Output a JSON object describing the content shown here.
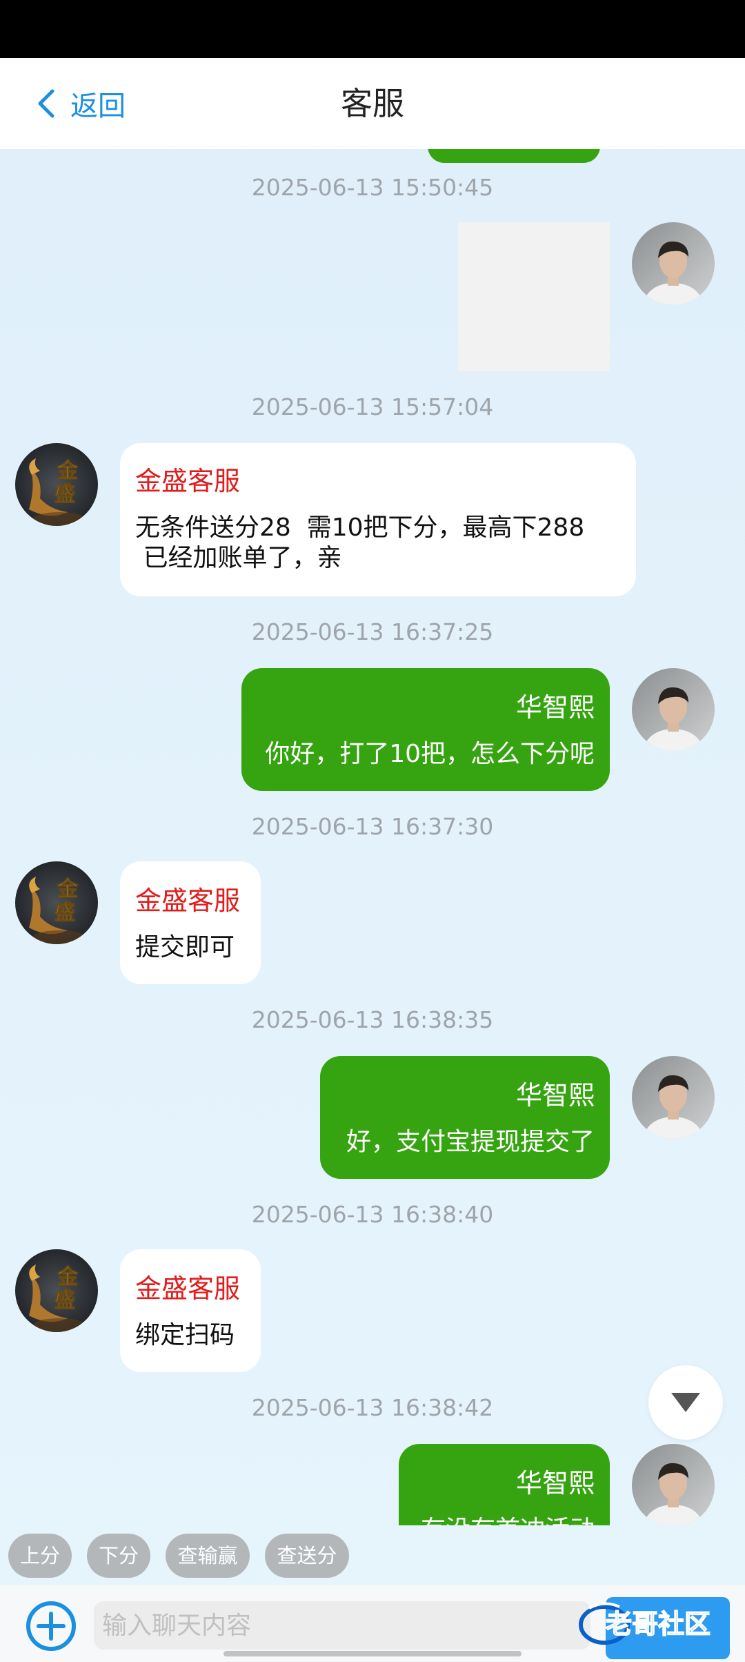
{
  "header": {
    "back_label": "返回",
    "title": "客服"
  },
  "messages": [
    {
      "timestamp": "2025-06-13 15:50:45",
      "side": "right",
      "type": "image"
    },
    {
      "timestamp": "2025-06-13 15:57:04",
      "side": "left",
      "sender": "金盛客服",
      "lines": [
        "无条件送分28  需10把下分，最高下288",
        " 已经加账单了，亲"
      ]
    },
    {
      "timestamp": "2025-06-13 16:37:25",
      "side": "right",
      "sender": "华智熙",
      "lines": [
        "你好，打了10把，怎么下分呢"
      ]
    },
    {
      "timestamp": "2025-06-13 16:37:30",
      "side": "left",
      "sender": "金盛客服",
      "lines": [
        "提交即可"
      ]
    },
    {
      "timestamp": "2025-06-13 16:38:35",
      "side": "right",
      "sender": "华智熙",
      "lines": [
        "好，支付宝提现提交了"
      ]
    },
    {
      "timestamp": "2025-06-13 16:38:40",
      "side": "left",
      "sender": "金盛客服",
      "lines": [
        "绑定扫码"
      ]
    },
    {
      "timestamp": "2025-06-13 16:38:42",
      "side": "right",
      "sender": "华智熙",
      "lines": [
        "有没有首冲活动"
      ]
    }
  ],
  "agent_avatar_text": [
    "金",
    "盛"
  ],
  "quick_actions": [
    "上分",
    "下分",
    "查输赢",
    "查送分"
  ],
  "input": {
    "placeholder": "输入聊天内容"
  },
  "watermark_text": "老哥社区",
  "icons": {
    "back": "chevron-left-icon",
    "scroll_down": "triangle-down-icon",
    "add": "plus-circle-icon"
  },
  "colors": {
    "accent_blue": "#1b8fe0",
    "bubble_green": "#36a411",
    "sender_red": "#e01c1c",
    "timestamp_gray": "#9ea4aa",
    "chip_gray": "#b4b7ba"
  }
}
